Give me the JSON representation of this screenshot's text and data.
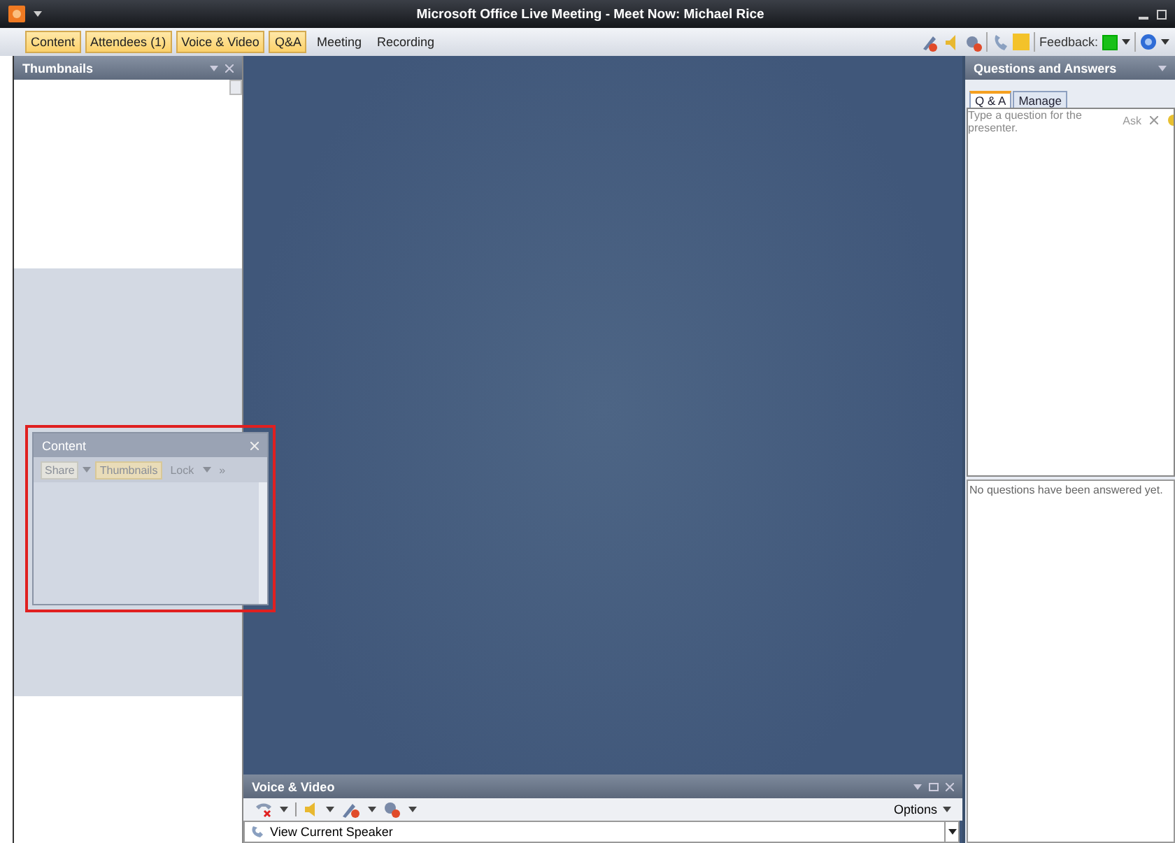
{
  "window": {
    "title": "Microsoft Office Live Meeting - Meet Now: Michael Rice"
  },
  "menu": [
    {
      "label": "Content",
      "selected": true
    },
    {
      "label": "Attendees (1)",
      "selected": true
    },
    {
      "label": "Voice & Video",
      "selected": true
    },
    {
      "label": "Q&A",
      "selected": true
    },
    {
      "label": "Meeting",
      "selected": false
    },
    {
      "label": "Recording",
      "selected": false
    }
  ],
  "toolbar": {
    "feedback_label": "Feedback:"
  },
  "thumbnails_panel": {
    "title": "Thumbnails"
  },
  "content_window": {
    "title": "Content",
    "buttons": [
      {
        "label": "Share",
        "kind": "split",
        "selected": false
      },
      {
        "label": "Thumbnails",
        "kind": "toggle",
        "selected": true
      },
      {
        "label": "Lock",
        "kind": "dropdown",
        "selected": false
      },
      {
        "label": "»",
        "kind": "overflow",
        "selected": false
      }
    ]
  },
  "qa_panel": {
    "title": "Questions and Answers",
    "tabs": [
      {
        "label": "Q & A",
        "selected": true
      },
      {
        "label": "Manage",
        "selected": false
      }
    ],
    "placeholder": "Type a question for the presenter.",
    "ask_button": "Ask",
    "answered_message": "No questions have been answered yet."
  },
  "voice_video": {
    "title": "Voice & Video",
    "options": "Options",
    "speaker": "View Current Speaker"
  }
}
